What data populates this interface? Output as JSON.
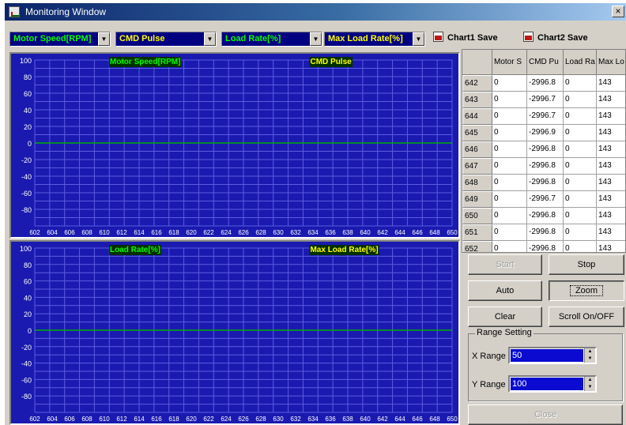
{
  "window": {
    "title": "Monitoring Window",
    "close_glyph": "×"
  },
  "toolbar": {
    "combos": [
      {
        "label": "Motor Speed[RPM]",
        "color": "#00ff00"
      },
      {
        "label": "CMD Pulse",
        "color": "#ffff00"
      },
      {
        "label": "Load Rate[%]",
        "color": "#00ff00"
      },
      {
        "label": "Max Load Rate[%]",
        "color": "#ffff00"
      }
    ],
    "chart1_save": "Chart1 Save",
    "chart2_save": "Chart2 Save"
  },
  "chart_data": [
    {
      "type": "line",
      "background": "#1a1ab0",
      "grid": true,
      "series": [
        {
          "name": "Motor Speed[RPM]",
          "color": "#00ff00",
          "values": []
        },
        {
          "name": "CMD Pulse",
          "color": "#ffff00",
          "values": []
        }
      ],
      "yticks": [
        "100",
        "80",
        "60",
        "40",
        "20",
        "0",
        "-20",
        "-40",
        "-60",
        "-80"
      ],
      "ylim": [
        -100,
        100
      ],
      "zero_line_color": "#00b000",
      "xticks": [
        "602",
        "604",
        "606",
        "608",
        "610",
        "612",
        "614",
        "616",
        "618",
        "620",
        "622",
        "624",
        "626",
        "628",
        "630",
        "632",
        "634",
        "636",
        "638",
        "640",
        "642",
        "644",
        "646",
        "648",
        "650"
      ],
      "xlim": [
        602,
        650
      ]
    },
    {
      "type": "line",
      "background": "#1a1ab0",
      "grid": true,
      "series": [
        {
          "name": "Load Rate[%]",
          "color": "#00ff00",
          "values": []
        },
        {
          "name": "Max Load Rate[%]",
          "color": "#ffff00",
          "values": []
        }
      ],
      "yticks": [
        "100",
        "80",
        "60",
        "40",
        "20",
        "0",
        "-20",
        "-40",
        "-60",
        "-80"
      ],
      "ylim": [
        -100,
        100
      ],
      "zero_line_color": "#00b000",
      "xticks": [
        "602",
        "604",
        "606",
        "608",
        "610",
        "612",
        "614",
        "616",
        "618",
        "620",
        "622",
        "624",
        "626",
        "628",
        "630",
        "632",
        "634",
        "636",
        "638",
        "640",
        "642",
        "644",
        "646",
        "648",
        "650"
      ],
      "xlim": [
        602,
        650
      ]
    }
  ],
  "grid": {
    "headers": [
      "",
      "Motor S",
      "CMD Pu",
      "Load Ra",
      "Max Lo"
    ],
    "rows": [
      [
        "642",
        "0",
        "-2996.8",
        "0",
        "143"
      ],
      [
        "643",
        "0",
        "-2996.7",
        "0",
        "143"
      ],
      [
        "644",
        "0",
        "-2996.7",
        "0",
        "143"
      ],
      [
        "645",
        "0",
        "-2996.9",
        "0",
        "143"
      ],
      [
        "646",
        "0",
        "-2996.8",
        "0",
        "143"
      ],
      [
        "647",
        "0",
        "-2996.8",
        "0",
        "143"
      ],
      [
        "648",
        "0",
        "-2996.8",
        "0",
        "143"
      ],
      [
        "649",
        "0",
        "-2996.7",
        "0",
        "143"
      ],
      [
        "650",
        "0",
        "-2996.8",
        "0",
        "143"
      ],
      [
        "651",
        "0",
        "-2996.8",
        "0",
        "143"
      ],
      [
        "652",
        "0",
        "-2996.8",
        "0",
        "143"
      ]
    ]
  },
  "buttons": {
    "start": "Start",
    "stop": "Stop",
    "auto": "Auto",
    "zoom": "Zoom",
    "clear": "Clear",
    "scroll": "Scroll On/OFF",
    "close": "Close"
  },
  "range": {
    "title": "Range Setting",
    "x_label": "X Range",
    "x_value": "50",
    "y_label": "Y Range",
    "y_value": "100"
  }
}
